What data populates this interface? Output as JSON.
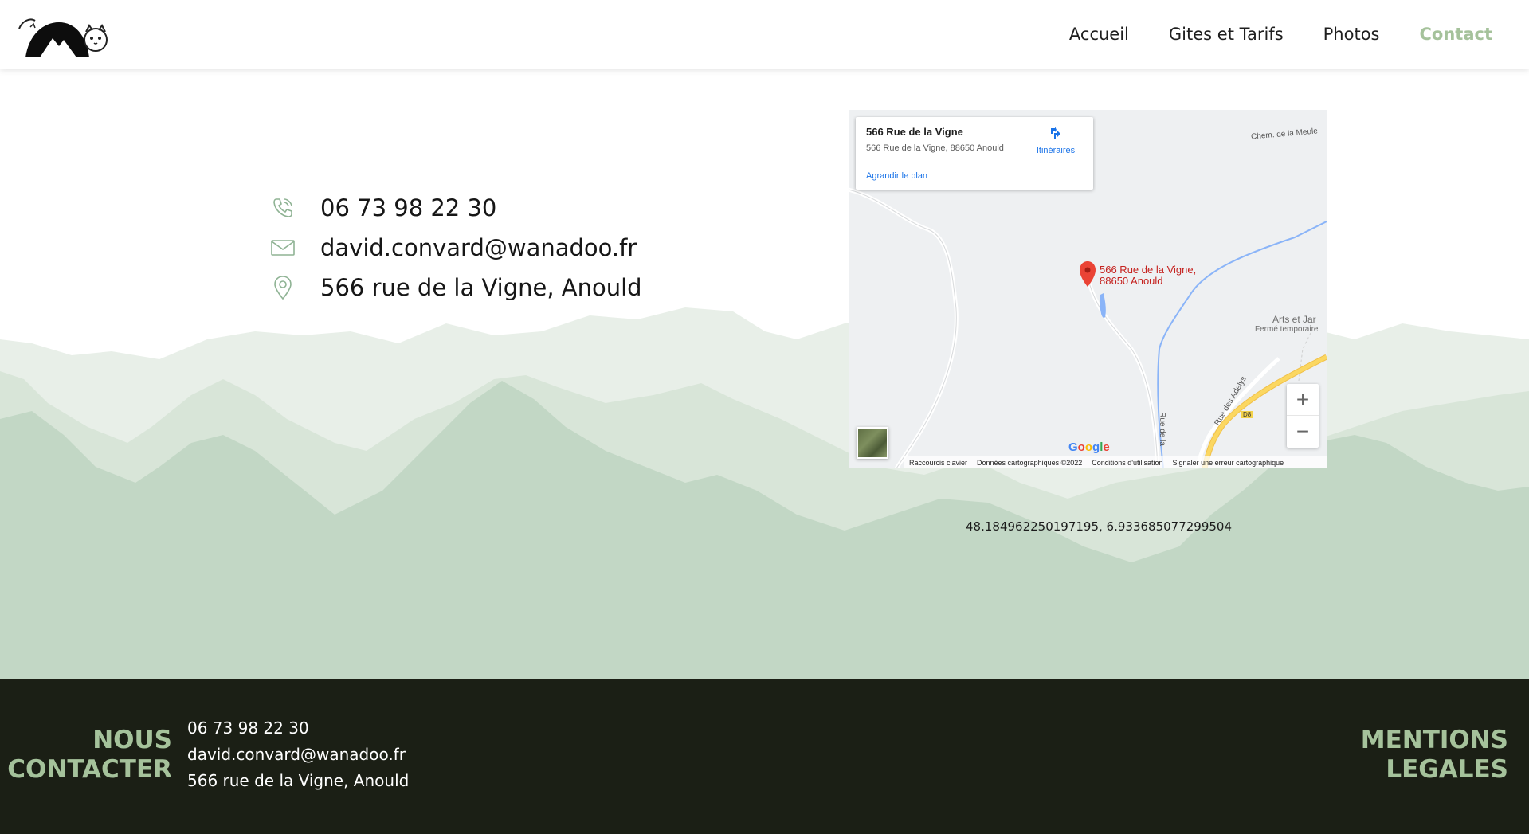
{
  "nav": {
    "items": [
      "Accueil",
      "Gites et Tarifs",
      "Photos",
      "Contact"
    ],
    "active": "Contact"
  },
  "contact": {
    "phone": "06 73 98 22 30",
    "email": "david.convard@wanadoo.fr",
    "address": "566 rue de la Vigne, Anould"
  },
  "map": {
    "place_title": "566 Rue de la Vigne",
    "place_address": "566 Rue de la Vigne, 88650 Anould",
    "enlarge_link": "Agrandir le plan",
    "directions_label": "Itinéraires",
    "pin_label_line1": "566 Rue de la Vigne,",
    "pin_label_line2": "88650 Anould",
    "poi_name": "Arts et Jar",
    "poi_status": "Fermé temporaire",
    "road_chem": "Chem. de la Meule",
    "road_adelys": "Rue des Adelys",
    "road_vigne": "Rue de la",
    "road_d8": "D8",
    "zoom_in": "+",
    "zoom_out": "−",
    "google": "Google",
    "attribution": [
      "Raccourcis clavier",
      "Données cartographiques ©2022",
      "Conditions d'utilisation",
      "Signaler une erreur cartographique"
    ]
  },
  "coordinates": "48.184962250197195, 6.933685077299504",
  "footer": {
    "contact_title_line1": "NOUS",
    "contact_title_line2": "CONTACTER",
    "phone": "06 73 98 22 30",
    "email": "david.convard@wanadoo.fr",
    "address": "566 rue de la Vigne, Anould",
    "legal_line1": "MENTIONS",
    "legal_line2": "LEGALES"
  },
  "colors": {
    "accent": "#a5c29b",
    "footer_bg": "#1b1f15",
    "mountain_light": "#e8efe8",
    "mountain_mid": "#d5e3d6",
    "mountain_dark": "#c1d6c4"
  }
}
